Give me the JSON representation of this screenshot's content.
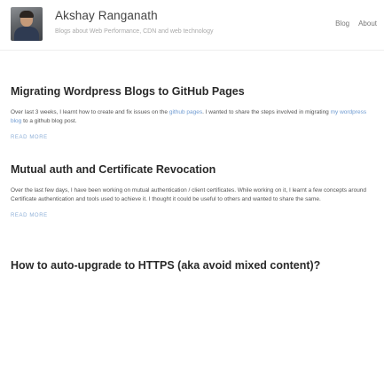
{
  "header": {
    "title": "Akshay Ranganath",
    "tagline": "Blogs about Web Performance, CDN and web technology",
    "nav": [
      {
        "label": "Blog"
      },
      {
        "label": "About"
      }
    ]
  },
  "posts": [
    {
      "title": "Migrating Wordpress Blogs to GitHub Pages",
      "excerpt_before": "Over last 3 weeks, I learnt how to create and fix issues on the ",
      "excerpt_link1": "github pages",
      "excerpt_mid": ". I wanted to share the steps involved in migrating ",
      "excerpt_link2": "my wordpress blog",
      "excerpt_after": " to a github blog post.",
      "read_more": "READ MORE"
    },
    {
      "title": "Mutual auth and Certificate Revocation",
      "excerpt": "Over the last few days, I have been working on mutual authentication / client certificates. While working on it, I learnt a few concepts around Certificate authentication and tools used to achieve it. I thought it could be useful to others and wanted to share the same.",
      "read_more": "READ MORE"
    },
    {
      "title": "How to auto-upgrade to HTTPS (aka avoid mixed content)?"
    }
  ]
}
